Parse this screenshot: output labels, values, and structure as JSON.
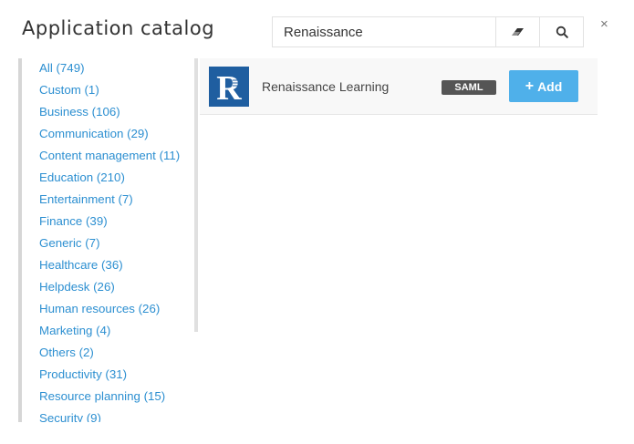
{
  "header": {
    "title": "Application catalog"
  },
  "search": {
    "value": "Renaissance"
  },
  "close": {
    "label": "×"
  },
  "categories": [
    {
      "label": "All (749)"
    },
    {
      "label": "Custom (1)"
    },
    {
      "label": "Business (106)"
    },
    {
      "label": "Communication (29)"
    },
    {
      "label": "Content management (11)"
    },
    {
      "label": "Education (210)"
    },
    {
      "label": "Entertainment (7)"
    },
    {
      "label": "Finance (39)"
    },
    {
      "label": "Generic (7)"
    },
    {
      "label": "Healthcare (36)"
    },
    {
      "label": "Helpdesk (26)"
    },
    {
      "label": "Human resources (26)"
    },
    {
      "label": "Marketing (4)"
    },
    {
      "label": "Others (2)"
    },
    {
      "label": "Productivity (31)"
    },
    {
      "label": "Resource planning (15)"
    },
    {
      "label": "Security (9)"
    }
  ],
  "results": [
    {
      "name": "Renaissance Learning",
      "badge": "SAML",
      "add_plus": "+",
      "add_label": "Add",
      "logo_letter": "R"
    }
  ],
  "icons": {
    "clear": "eraser-icon",
    "search": "search-icon",
    "close": "close-icon",
    "logo": "renaissance-logo"
  },
  "colors": {
    "link": "#2c8fd1",
    "accent": "#4fb0ea",
    "badge": "#555555",
    "logo": "#1f5ea0"
  }
}
